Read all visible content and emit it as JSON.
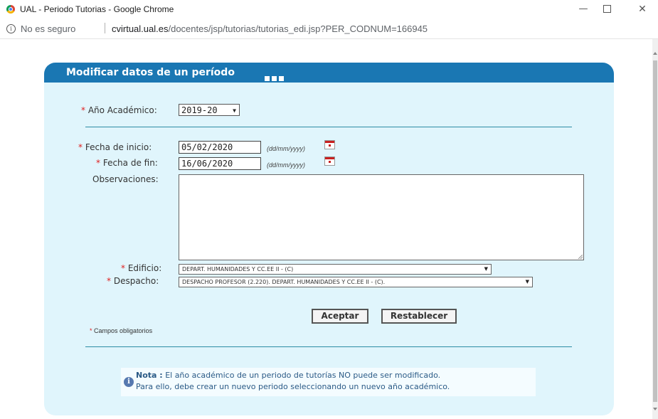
{
  "window": {
    "title": "UAL - Periodo Tutorias - Google Chrome",
    "minimize": "—",
    "close": "✕"
  },
  "addressbar": {
    "security": "No es seguro",
    "domain": "cvirtual.ual.es",
    "path": "/docentes/jsp/tutorias/tutorias_edi.jsp?PER_CODNUM=166945"
  },
  "form": {
    "title": "Modificar datos de un período",
    "required_mark": "*",
    "academic_year_label": "Año Académico:",
    "academic_year_value": "2019-20",
    "start_date_label": "Fecha de inicio:",
    "start_date_value": "05/02/2020",
    "end_date_label": "Fecha de fin:",
    "end_date_value": "16/06/2020",
    "date_format": "(dd/mm/yyyy)",
    "observations_label": "Observaciones:",
    "building_label": "Edificio:",
    "building_value": "DEPART. HUMANIDADES Y CC.EE II - (C)",
    "office_label": "Despacho:",
    "office_value": "DESPACHO PROFESOR (2.220). DEPART. HUMANIDADES Y CC.EE II - (C).",
    "accept_button": "Aceptar",
    "reset_button": "Restablecer",
    "required_note": "Campos obligatorios",
    "note_title": "Nota :",
    "note_line1": "El año académico de un periodo de tutorías NO puede ser modificado.",
    "note_line2": "Para ello, debe crear un nuevo periodo seleccionando un nuevo año académico.",
    "dropdown_arrow": "▼"
  },
  "colors": {
    "header": "#1a77b3",
    "panel": "#e0f5fc",
    "required": "#e02020",
    "note_text": "#2a5a86"
  }
}
